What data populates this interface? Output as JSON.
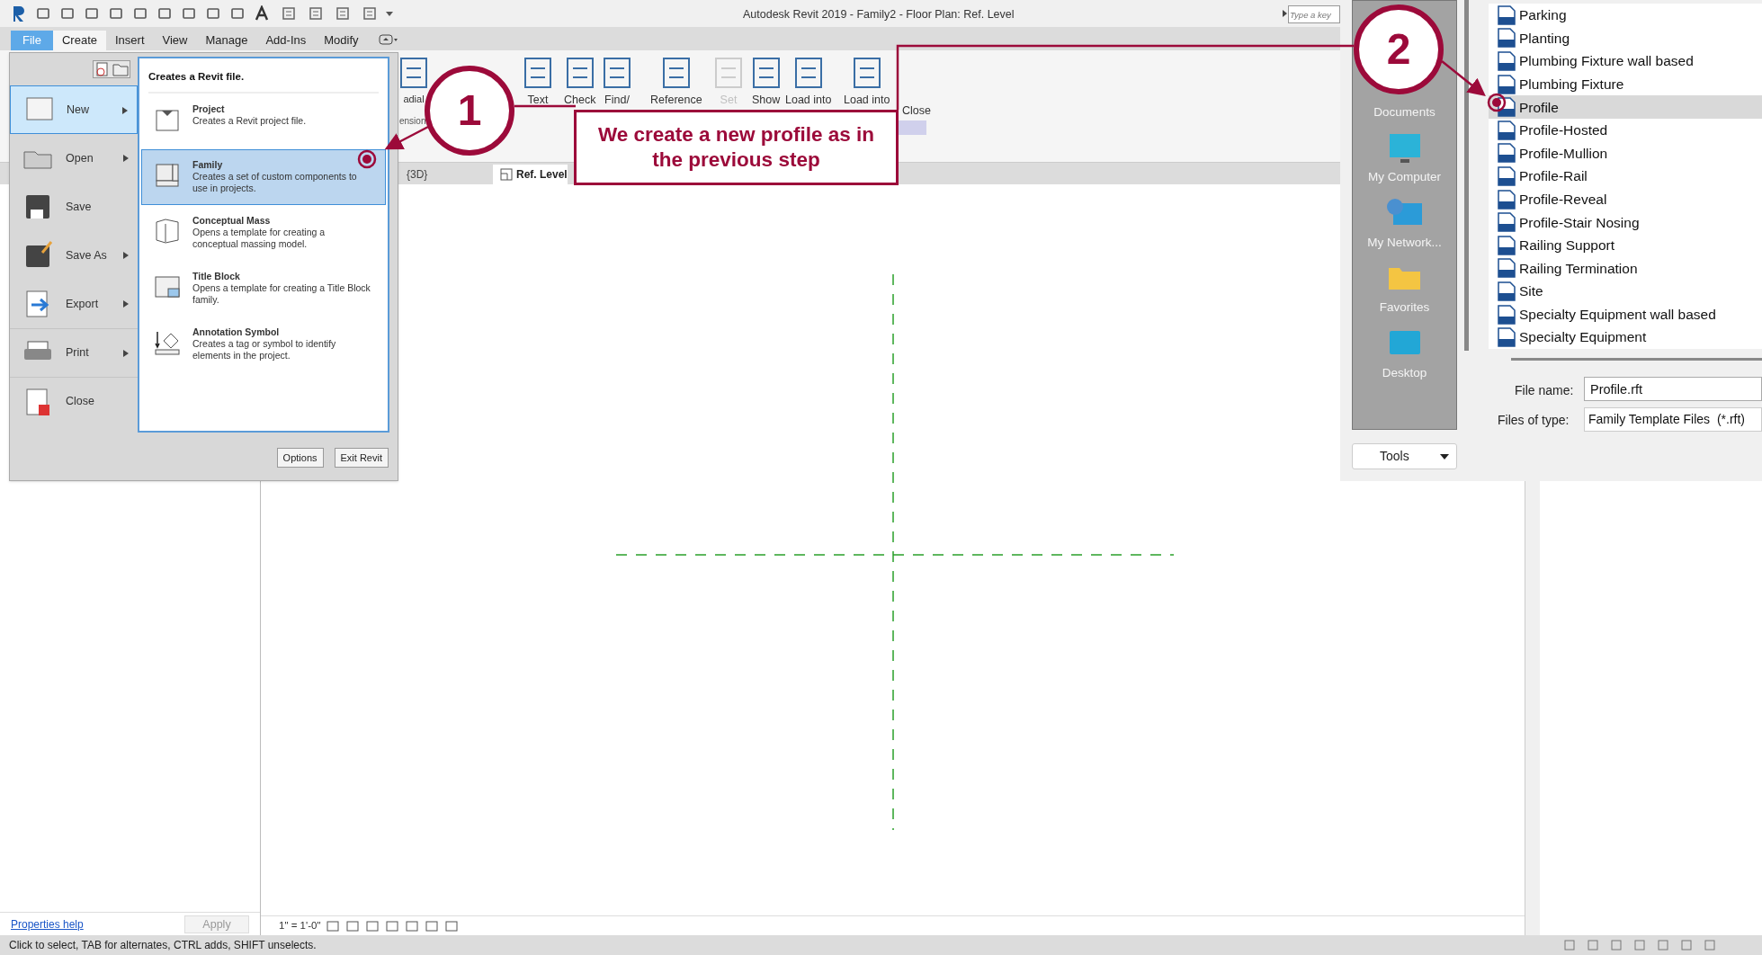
{
  "title_bar": {
    "title": "Autodesk Revit 2019 - Family2 - Floor Plan: Ref. Level",
    "search_placeholder": "Type a key"
  },
  "ribbon_tabs": [
    {
      "label": "File",
      "selected": false,
      "kind": "file"
    },
    {
      "label": "Create",
      "selected": true,
      "kind": "tab"
    },
    {
      "label": "Insert",
      "selected": false,
      "kind": "tab"
    },
    {
      "label": "View",
      "selected": false,
      "kind": "tab"
    },
    {
      "label": "Manage",
      "selected": false,
      "kind": "tab"
    },
    {
      "label": "Add-Ins",
      "selected": false,
      "kind": "tab"
    },
    {
      "label": "Modify",
      "selected": false,
      "kind": "tab"
    }
  ],
  "ribbon_tools": [
    {
      "label": "adial",
      "disabled": false
    },
    {
      "label": "Text",
      "disabled": false
    },
    {
      "label": "Check",
      "disabled": false
    },
    {
      "label": "Find/",
      "disabled": false
    },
    {
      "label": "Reference",
      "disabled": false
    },
    {
      "label": "Set",
      "disabled": true
    },
    {
      "label": "Show",
      "disabled": false
    },
    {
      "label": "Load into",
      "disabled": false
    },
    {
      "label": "Load into",
      "disabled": false
    }
  ],
  "ribbon_panel_labels": [
    "ension",
    "Close"
  ],
  "view_tabs": [
    {
      "label": "{3D}",
      "selected": false
    },
    {
      "label": "Ref. Level",
      "selected": true
    }
  ],
  "file_menu": {
    "items": [
      {
        "label": "New",
        "submenu": true,
        "selected": true
      },
      {
        "label": "Open",
        "submenu": true,
        "selected": false
      },
      {
        "label": "Save",
        "submenu": false,
        "selected": false
      },
      {
        "label": "Save As",
        "submenu": true,
        "selected": false
      },
      {
        "label": "Export",
        "submenu": true,
        "selected": false
      },
      {
        "label": "Print",
        "submenu": true,
        "selected": false
      },
      {
        "label": "Close",
        "submenu": false,
        "selected": false
      }
    ],
    "panel_title": "Creates a Revit file.",
    "options": [
      {
        "title": "Project",
        "description": "Creates a Revit project file.",
        "selected": false
      },
      {
        "title": "Family",
        "description": "Creates a set of custom components to use in projects.",
        "selected": true
      },
      {
        "title": "Conceptual Mass",
        "description": "Opens a template for creating a conceptual massing model.",
        "selected": false
      },
      {
        "title": "Title Block",
        "description": "Opens a template for creating a Title Block family.",
        "selected": false
      },
      {
        "title": "Annotation Symbol",
        "description": "Creates a tag or symbol to identify elements in the project.",
        "selected": false
      }
    ],
    "buttons": [
      "Options",
      "Exit Revit"
    ]
  },
  "properties": {
    "help_link": "Properties help",
    "apply": "Apply"
  },
  "view_bar": {
    "scale": "1\" = 1'-0\""
  },
  "status_bar": "Click to select, TAB for alternates, CTRL adds, SHIFT unselects.",
  "file_dialog": {
    "places": [
      "Documents",
      "My Computer",
      "My Network...",
      "Favorites",
      "Desktop"
    ],
    "files": [
      {
        "name": "Parking",
        "selected": false
      },
      {
        "name": "Planting",
        "selected": false
      },
      {
        "name": "Plumbing Fixture wall based",
        "selected": false
      },
      {
        "name": "Plumbing Fixture",
        "selected": false
      },
      {
        "name": "Profile",
        "selected": true
      },
      {
        "name": "Profile-Hosted",
        "selected": false
      },
      {
        "name": "Profile-Mullion",
        "selected": false
      },
      {
        "name": "Profile-Rail",
        "selected": false
      },
      {
        "name": "Profile-Reveal",
        "selected": false
      },
      {
        "name": "Profile-Stair Nosing",
        "selected": false
      },
      {
        "name": "Railing Support",
        "selected": false
      },
      {
        "name": "Railing Termination",
        "selected": false
      },
      {
        "name": "Site",
        "selected": false
      },
      {
        "name": "Specialty Equipment wall based",
        "selected": false
      },
      {
        "name": "Specialty Equipment",
        "selected": false
      }
    ],
    "file_name_label": "File name:",
    "file_name": "Profile.rft",
    "type_label": "Files of type:",
    "file_type": "Family Template Files  (*.rft)",
    "tools": "Tools"
  },
  "annotations": {
    "steps": [
      "1",
      "2"
    ],
    "note": "We create a new profile as in the previous step"
  }
}
